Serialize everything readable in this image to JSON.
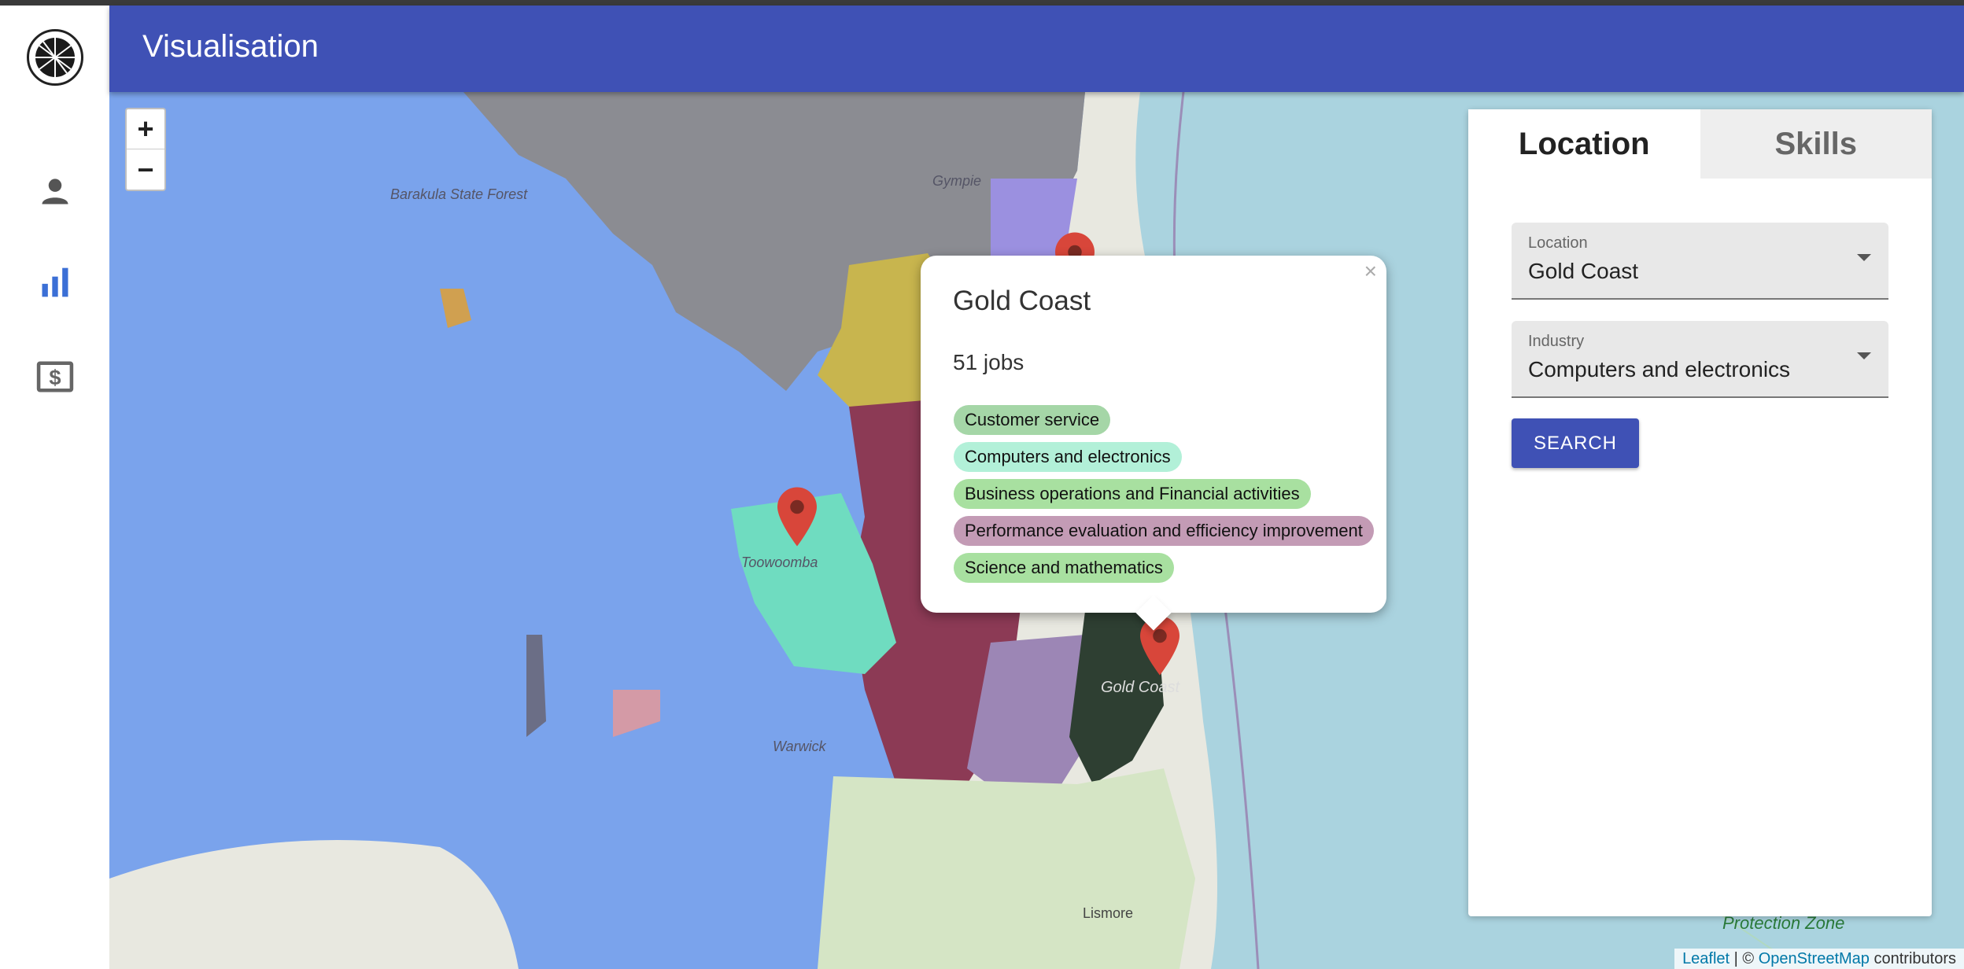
{
  "header": {
    "title": "Visualisation"
  },
  "sidebar": {
    "items": [
      {
        "icon": "person-icon"
      },
      {
        "icon": "bar-chart-icon"
      },
      {
        "icon": "dollar-icon"
      }
    ]
  },
  "map": {
    "zoom_in": "+",
    "zoom_out": "−",
    "labels": [
      "Barakula State Forest",
      "Gympie",
      "Toowoomba",
      "Warwick",
      "Gold Coast",
      "Lismore",
      "Protection Zone"
    ],
    "attribution": {
      "leaflet": "Leaflet",
      "separator": " | © ",
      "osm": "OpenStreetMap",
      "suffix": " contributors"
    }
  },
  "popup": {
    "title": "Gold Coast",
    "jobs": "51 jobs",
    "close": "×",
    "skills": [
      {
        "label": "Customer service",
        "color": "#a5d6a7"
      },
      {
        "label": "Computers and electronics",
        "color": "#b2f0d8"
      },
      {
        "label": "Business operations and Financial activities",
        "color": "#a8e0a0"
      },
      {
        "label": "Performance evaluation and efficiency improvement",
        "color": "#c39bb5"
      },
      {
        "label": "Science and mathematics",
        "color": "#a8e0a0"
      }
    ]
  },
  "panel": {
    "tabs": [
      {
        "label": "Location"
      },
      {
        "label": "Skills"
      }
    ],
    "location": {
      "label": "Location",
      "value": "Gold Coast"
    },
    "industry": {
      "label": "Industry",
      "value": "Computers and electronics"
    },
    "search": "SEARCH"
  }
}
